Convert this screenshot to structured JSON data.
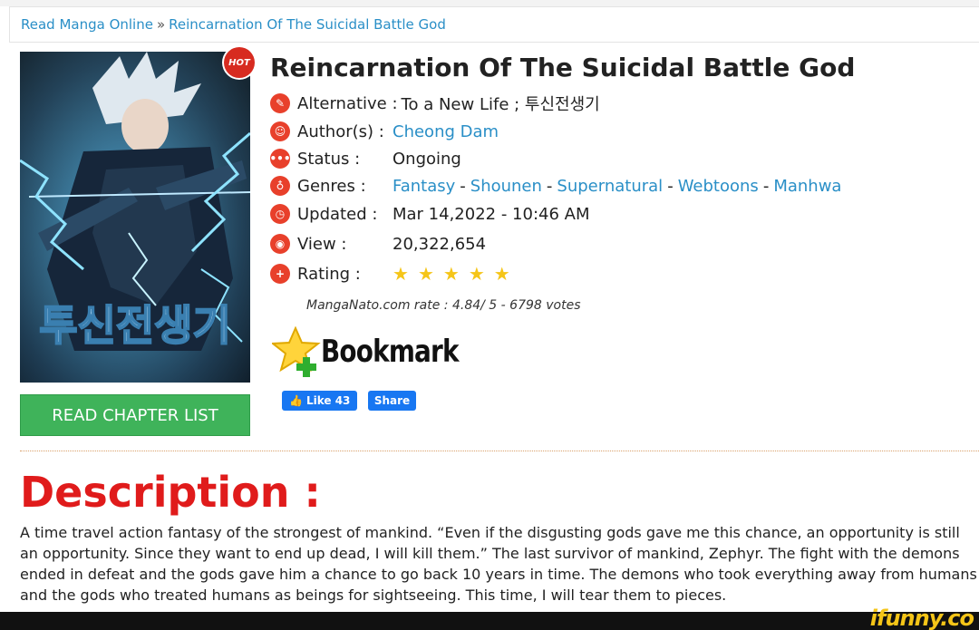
{
  "breadcrumb": {
    "home": "Read Manga Online",
    "separator": "»",
    "current": "Reincarnation Of The Suicidal Battle God"
  },
  "badge": {
    "hot": "HOT"
  },
  "manga": {
    "title": "Reincarnation Of The Suicidal Battle God",
    "alternative_label": "Alternative :",
    "alternative_value": "To a New Life ; 투신전생기",
    "author_label": "Author(s) :",
    "author_value": "Cheong Dam",
    "status_label": "Status :",
    "status_value": "Ongoing",
    "genres_label": "Genres :",
    "genres": [
      "Fantasy",
      "Shounen",
      "Supernatural",
      "Webtoons",
      "Manhwa"
    ],
    "genre_separator": "-",
    "updated_label": "Updated :",
    "updated_value": "Mar 14,2022 - 10:46 AM",
    "view_label": "View :",
    "view_value": "20,322,654",
    "rating_label": "Rating :",
    "rating_stars": 5,
    "rate_text": "MangaNato.com rate : 4.84/ 5 - 6798 votes"
  },
  "cover_title_korean": "투신전생기",
  "buttons": {
    "read_chapter_list": "READ CHAPTER LIST",
    "bookmark": "Bookmark",
    "fb_like": "Like 43",
    "fb_share": "Share"
  },
  "description": {
    "heading": "Description :",
    "text": "A time travel action fantasy of the strongest of mankind. “Even if the disgusting gods gave me this chance, an opportunity is still an opportunity. Since they want to end up dead, I will kill them.” The last survivor of mankind, Zephyr. The fight with the demons ended in defeat and the gods gave him a chance to go back 10 years in time. The demons who took everything away from humans and the gods who treated humans as beings for sightseeing. This time, I will tear them to pieces."
  },
  "watermark": "ifunny.co",
  "colors": {
    "link": "#2a8fc7",
    "accent_red": "#e01b1b",
    "icon_red": "#e8402b",
    "button_green": "#3fb35a",
    "star_gold": "#f5c518",
    "facebook_blue": "#1877f2"
  },
  "icons": {
    "alternative": "alternative-icon",
    "author": "author-icon",
    "status": "status-icon",
    "genres": "genres-icon",
    "updated": "updated-icon",
    "view": "view-icon",
    "rating": "rating-plus-icon",
    "bookmark": "star-plus-icon",
    "like": "thumbs-up-icon"
  }
}
